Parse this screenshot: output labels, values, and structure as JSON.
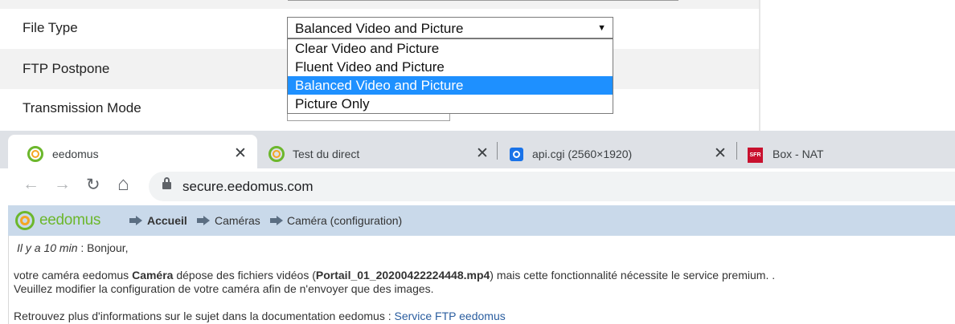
{
  "settings": {
    "file_type_label": "File Type",
    "ftp_postpone_label": "FTP Postpone",
    "transmission_mode_label": "Transmission Mode",
    "file_type_select": {
      "selected": "Balanced Video and Picture",
      "arrow": "▼",
      "options": [
        "Clear Video and Picture",
        "Fluent Video and Picture",
        "Balanced Video and Picture",
        "Picture Only"
      ]
    }
  },
  "browser": {
    "tabs": [
      {
        "title": "eedomus",
        "icon": "eedomus-favicon",
        "active": true
      },
      {
        "title": "Test du direct",
        "icon": "eedomus-favicon",
        "active": false
      },
      {
        "title": "api.cgi (2560×1920)",
        "icon": "image-favicon",
        "active": false
      },
      {
        "title": "Box - NAT",
        "icon": "sfr-favicon",
        "favicon_text": "SFR",
        "active": false
      }
    ],
    "close_glyph": "✕",
    "nav": {
      "back": "←",
      "forward": "→",
      "reload": "↻",
      "home": "⌂"
    },
    "url": "secure.eedomus.com"
  },
  "eedomus": {
    "logo_text": "eedomus",
    "breadcrumbs": [
      "Accueil",
      "Caméras",
      "Caméra (configuration)"
    ],
    "message": {
      "time": "Il y a 10 min",
      "greeting": " : Bonjour,",
      "line2_pre": "votre caméra eedomus ",
      "camera_name": "Caméra",
      "line2_mid": " dépose des fichiers vidéos (",
      "file_name": "Portail_01_20200422224448.mp4",
      "line2_post": ") mais cette fonctionnalité nécessite le service premium. .",
      "line3": "Veuillez modifier la configuration de votre caméra afin de n'envoyer que des images.",
      "line4_pre": "Retrouvez plus d'informations sur le sujet dans la documentation eedomus : ",
      "link_text": "Service FTP eedomus"
    }
  },
  "colors": {
    "select_highlight": "#1e90ff",
    "eedomus_header_bg": "#c9d9ea",
    "eedomus_green": "#6cb72c",
    "eedomus_orange": "#f5a623",
    "link": "#2a5d9f"
  }
}
